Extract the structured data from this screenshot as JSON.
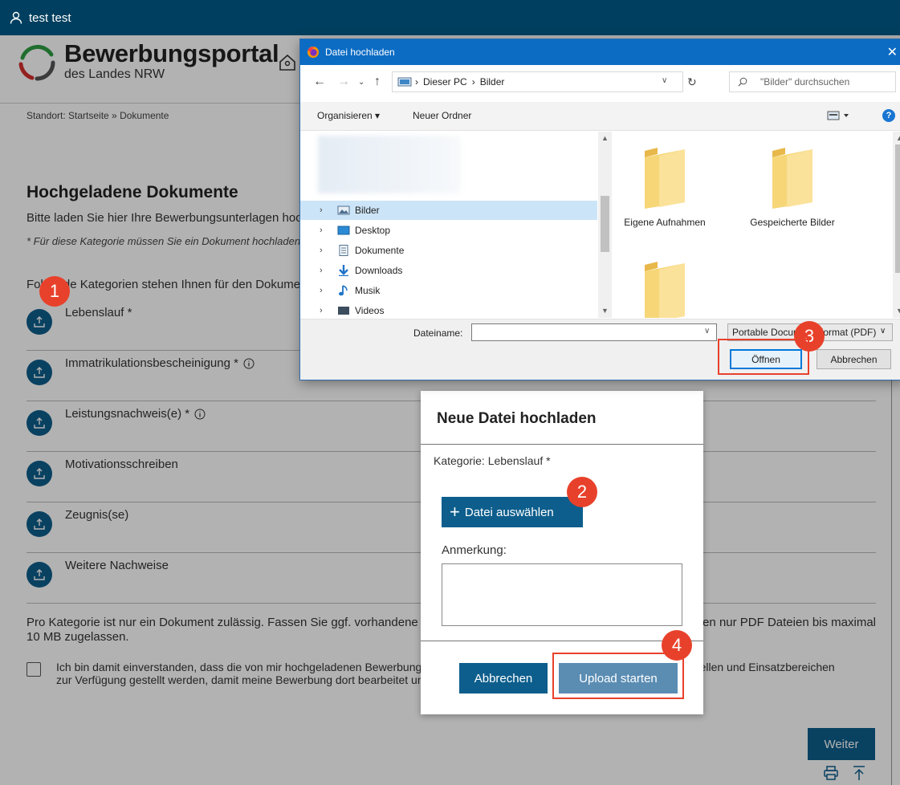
{
  "topbar": {
    "user": "test test"
  },
  "logo": {
    "title": "Bewerbungsportal",
    "subtitle": "des Landes NRW"
  },
  "breadcrumb": "Standort: Startseite  » Dokumente",
  "page": {
    "title": "Hochgeladene Dokumente",
    "intro": "Bitte laden Sie hier Ihre Bewerbungsunterlagen hoch.",
    "required_note": "* Für diese Kategorie müssen Sie ein Dokument hochladen.",
    "categories_intro": "Folgende Kategorien stehen Ihnen für den Dokumentenupload zur Verfügung:"
  },
  "categories": [
    {
      "label": "Lebenslauf *",
      "info": false
    },
    {
      "label": "Immatrikulationsbescheinigung *",
      "info": true
    },
    {
      "label": "Leistungsnachweis(e) *",
      "info": true
    },
    {
      "label": "Motivationsschreiben",
      "info": false
    },
    {
      "label": "Zeugnis(se)",
      "info": false
    },
    {
      "label": "Weitere Nachweise",
      "info": false
    }
  ],
  "rules_text": "Pro Kategorie ist nur ein Dokument zulässig. Fassen Sie ggf. vorhandene Dokumente in einem Dokument zusammen. Es werden nur PDF Dateien bis maximal 10 MB zugelassen.",
  "consent_text": "Ich bin damit einverstanden, dass die von mir hochgeladenen Bewerbungsunterlagen bzw. Dokumente allen relevan- ten Dienststellen und Einsatzbereichen zur Verfügung gestellt werden, damit meine Bewerbung dort bearbeitet und geprüft werden kann. *",
  "weiter_label": "Weiter",
  "modal": {
    "title": "Neue Datei hochladen",
    "category": "Kategorie: Lebenslauf *",
    "choose_label": "Datei auswählen",
    "anmerkung_label": "Anmerkung:",
    "cancel_label": "Abbrechen",
    "start_label": "Upload starten"
  },
  "dialog": {
    "title": "Datei hochladen",
    "path_pc": "Dieser PC",
    "path_folder": "Bilder",
    "search_placeholder": "\"Bilder\" durchsuchen",
    "organize_label": "Organisieren",
    "new_folder_label": "Neuer Ordner",
    "help": "?",
    "tree": [
      {
        "label": "Bilder",
        "icon": "pictures-icon",
        "selected": true
      },
      {
        "label": "Desktop",
        "icon": "desktop-icon",
        "selected": false
      },
      {
        "label": "Dokumente",
        "icon": "documents-icon",
        "selected": false
      },
      {
        "label": "Downloads",
        "icon": "download-icon",
        "selected": false
      },
      {
        "label": "Musik",
        "icon": "music-icon",
        "selected": false
      },
      {
        "label": "Videos",
        "icon": "videos-icon",
        "selected": false
      }
    ],
    "folders": [
      "Eigene Aufnahmen",
      "Gespeicherte Bilder",
      ""
    ],
    "filename_label": "Dateiname:",
    "filename_value": "",
    "filter": "Portable Document Format (PDF)",
    "open_label": "Öffnen",
    "cancel_label": "Abbrechen"
  },
  "badges": [
    "1",
    "2",
    "3",
    "4"
  ],
  "colors": {
    "primary": "#0d5e8c",
    "topbar": "#003f5f",
    "annotation": "#e8412b",
    "win_title": "#0c6cc4"
  }
}
